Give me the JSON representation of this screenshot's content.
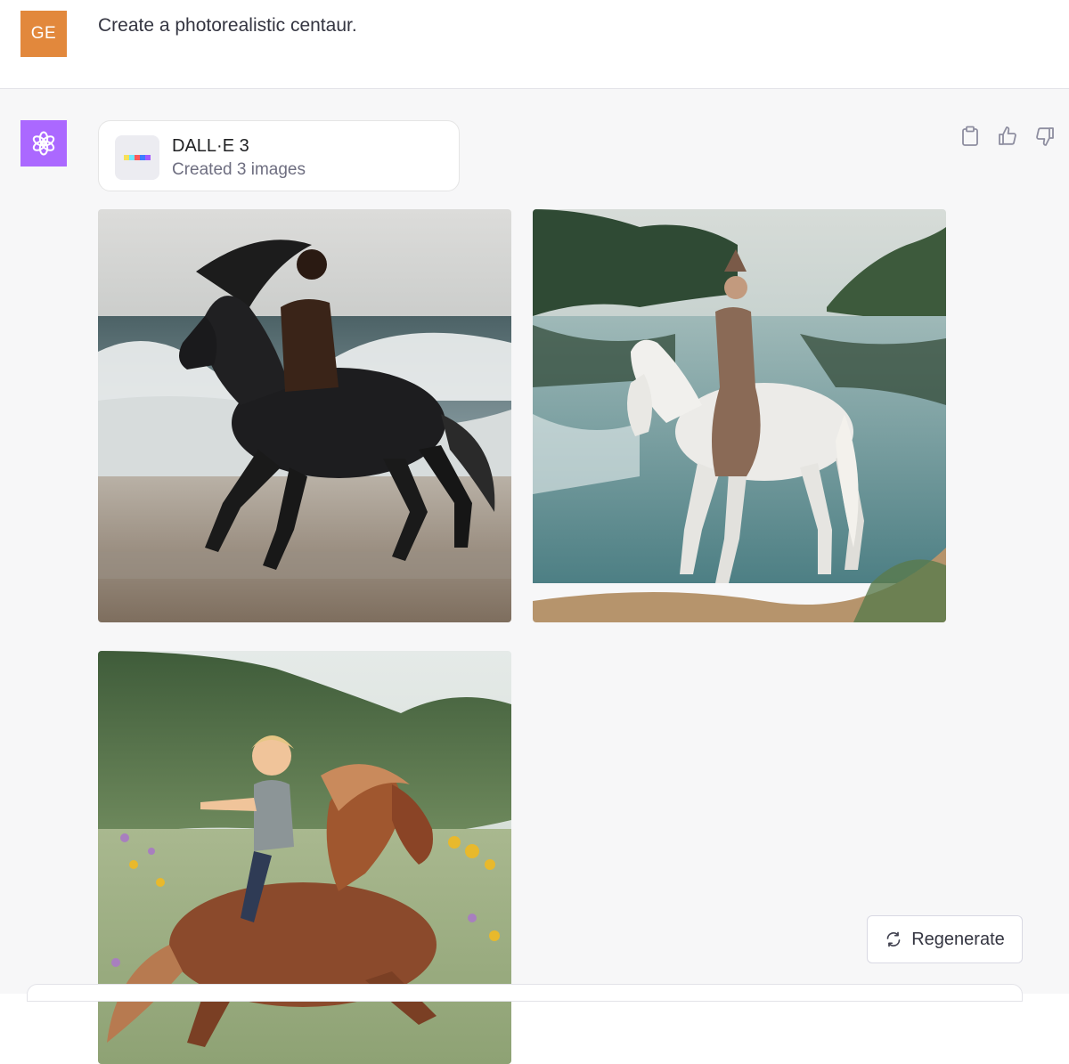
{
  "user_message": {
    "avatar_initials": "GE",
    "text": "Create a photorealistic centaur."
  },
  "assistant": {
    "avatar_icon": "openai-logo-icon",
    "tool_card": {
      "title": "DALL·E 3",
      "subtitle": "Created 3 images",
      "swatch_colors": [
        "#f7e15a",
        "#6ee7ff",
        "#ff5a5a",
        "#3d7bff",
        "#a259ff"
      ]
    },
    "actions": [
      "clipboard-icon",
      "thumbs-up-icon",
      "thumbs-down-icon"
    ],
    "images": [
      {
        "name": "generated-image-1",
        "subject": "black-centaur-beach"
      },
      {
        "name": "generated-image-2",
        "subject": "white-centaur-lake"
      },
      {
        "name": "generated-image-3",
        "subject": "child-pony-meadow"
      }
    ],
    "regenerate_label": "Regenerate"
  },
  "colors": {
    "user_avatar_bg": "#e2883c",
    "bot_avatar_bg": "#ab68ff",
    "assistant_row_bg": "#f7f7f8"
  }
}
